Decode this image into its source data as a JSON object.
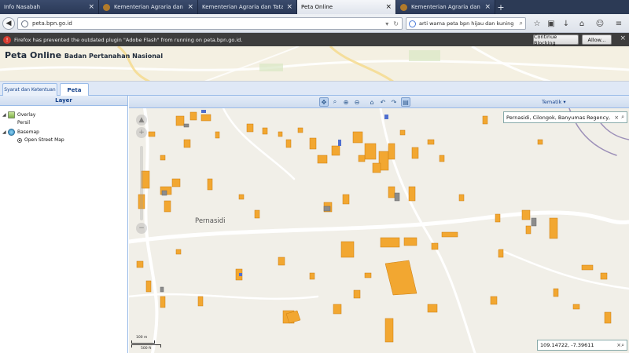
{
  "browser": {
    "tabs": [
      {
        "label": "Info Nasabah",
        "favicon": false,
        "active": false
      },
      {
        "label": "Kementerian Agraria dan Tata...",
        "favicon": true,
        "active": false
      },
      {
        "label": "Kementerian Agraria dan Tata Ru...",
        "favicon": false,
        "active": false
      },
      {
        "label": "Peta Online",
        "favicon": false,
        "active": true
      },
      {
        "label": "Kementerian Agraria dan Tata...",
        "favicon": true,
        "active": false
      }
    ],
    "url": "peta.bpn.go.id",
    "search_value": "arti warna peta bpn hijau dan kuning"
  },
  "notification": {
    "text": "Firefox has prevented the outdated plugin \"Adobe Flash\" from running on peta.bpn.go.id.",
    "continue_label": "Continue Blocking",
    "allow_label": "Allow..."
  },
  "header": {
    "title": "Peta Online",
    "subtitle": "Badan Pertanahan Nasional"
  },
  "page_tabs": [
    {
      "label": "Syarat dan Ketentuan",
      "active": false
    },
    {
      "label": "Peta",
      "active": true
    }
  ],
  "layer_panel": {
    "title": "Layer",
    "tree": [
      {
        "label": "Overlay",
        "level": 0,
        "icon": "overlay-icon"
      },
      {
        "label": "Persil",
        "level": 1,
        "icon": ""
      },
      {
        "label": "Basemap",
        "level": 0,
        "icon": "globe-icon"
      },
      {
        "label": "Open Street Map",
        "level": 1,
        "icon": "radio-icon"
      }
    ]
  },
  "map": {
    "tematik_label": "Tematik",
    "place_label": "Pernasidi",
    "search_value": "Pernasidi, Cilongok, Banyumas Regency, Ce",
    "coordinates": "109.14722, -7.39611",
    "scale_top": "100 m",
    "scale_bottom": "500 ft",
    "colors": {
      "parcel": "#f2a731",
      "parcel_border": "#c97c10",
      "gray_parcel": "#8c8c8c",
      "blue_parcel": "#4f6fd0",
      "background": "#f1efe8",
      "road": "#ffffff"
    }
  }
}
